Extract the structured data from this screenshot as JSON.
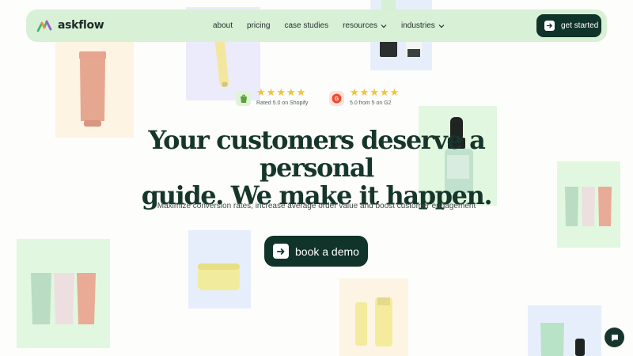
{
  "brand": {
    "name": "askflow"
  },
  "nav": {
    "links": [
      {
        "label": "about",
        "dropdown": false
      },
      {
        "label": "pricing",
        "dropdown": false
      },
      {
        "label": "case studies",
        "dropdown": false
      },
      {
        "label": "resources",
        "dropdown": true
      },
      {
        "label": "industries",
        "dropdown": true
      }
    ],
    "cta_label": "get started"
  },
  "ratings": [
    {
      "source": "shopify",
      "icon": "shopify-icon",
      "stars": 5,
      "text": "Rated 5.0 on Shopify"
    },
    {
      "source": "g2",
      "icon": "g2-icon",
      "stars": 5,
      "text": "5.0 from 5 on G2"
    }
  ],
  "hero": {
    "title_line1": "Your customers deserve a personal",
    "title_line2": "guide. We make it happen.",
    "subtitle": "Maximize conversion rates, increase average order value and boost customer engagement",
    "button_label": "book a demo"
  },
  "colors": {
    "nav_bg": "#d8f0d6",
    "dark_green": "#10332a",
    "star": "#f3c23c",
    "tile_peach": "#fdf4e3",
    "tile_lavender": "#ecebfb",
    "tile_mint": "#e2f7df",
    "tile_blue": "#e7eefb"
  },
  "icons": {
    "chat": "chat-bubble-icon",
    "arrow": "arrow-right-icon"
  }
}
